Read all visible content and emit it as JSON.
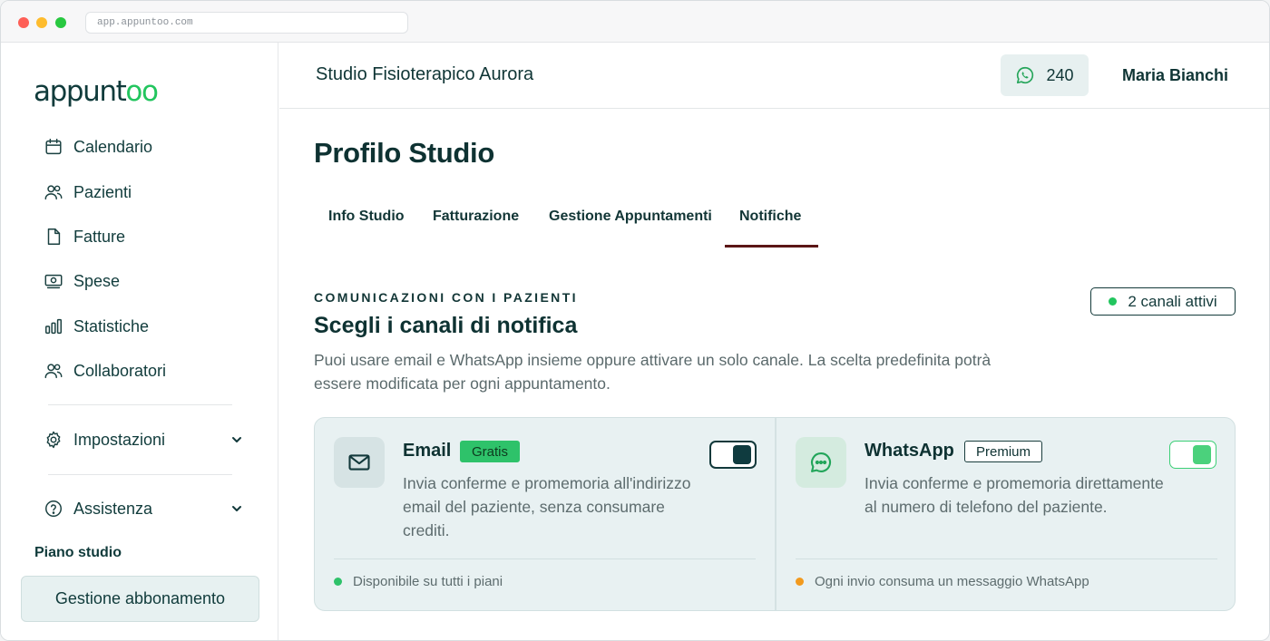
{
  "browser": {
    "url": "app.appuntoo.com"
  },
  "brand": {
    "logo_prefix": "appunt",
    "logo_suffix": "oo",
    "accent": "#22c55e",
    "primary": "#0f3a3a"
  },
  "sidebar": {
    "items": [
      {
        "label": "Calendario",
        "icon": "calendar-icon"
      },
      {
        "label": "Pazienti",
        "icon": "users-icon"
      },
      {
        "label": "Fatture",
        "icon": "document-icon"
      },
      {
        "label": "Spese",
        "icon": "money-icon"
      },
      {
        "label": "Statistiche",
        "icon": "bar-chart-icon"
      },
      {
        "label": "Collaboratori",
        "icon": "team-icon"
      }
    ],
    "settings_label": "Impostazioni",
    "help_label": "Assistenza",
    "plan_label": "Piano studio",
    "plan_button": "Gestione abbonamento"
  },
  "topbar": {
    "studio_name": "Studio Fisioterapico Aurora",
    "whatsapp_credits": "240",
    "user_name": "Maria Bianchi"
  },
  "main": {
    "title": "Profilo Studio",
    "tabs": [
      {
        "label": "Info Studio",
        "active": false
      },
      {
        "label": "Fatturazione",
        "active": false
      },
      {
        "label": "Gestione Appuntamenti",
        "active": false
      },
      {
        "label": "Notifiche",
        "active": true
      }
    ],
    "section": {
      "overline": "COMUNICAZIONI CON I PAZIENTI",
      "title": "Scegli i canali di notifica",
      "description": "Puoi usare email e WhatsApp insieme oppure attivare un solo canale. La scelta predefinita potrà essere modificata per ogni appuntamento.",
      "active_badge": "2 canali attivi"
    },
    "channels": {
      "email": {
        "name": "Email",
        "badge": "Gratis",
        "description": "Invia conferme e promemoria all'indirizzo email del paziente, senza consumare crediti.",
        "enabled": true,
        "footer": "Disponibile su tutti i piani"
      },
      "whatsapp": {
        "name": "WhatsApp",
        "badge": "Premium",
        "description": "Invia conferme e promemoria direttamente al numero di telefono del paziente.",
        "enabled": true,
        "footer": "Ogni invio consuma un messaggio WhatsApp"
      }
    }
  }
}
